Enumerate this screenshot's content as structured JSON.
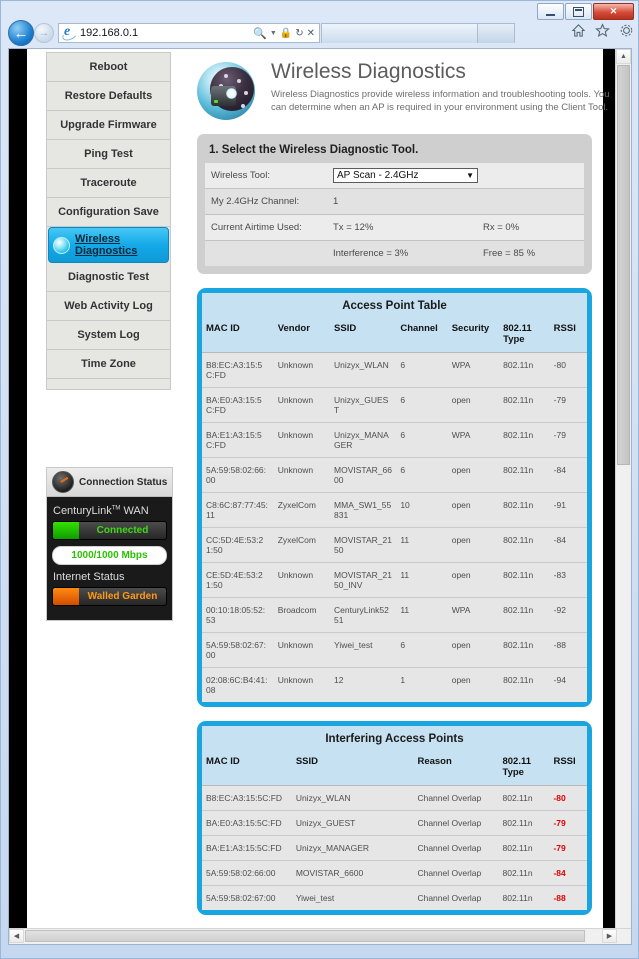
{
  "browser": {
    "url": "192.168.0.1",
    "back_icon": "back-arrow-icon",
    "forward_icon": "forward-arrow-icon",
    "search_icon": "magnifier-icon",
    "lock_icon": "lock-icon",
    "refresh_icon": "refresh-icon",
    "stop_icon": "close-icon",
    "home_icon": "home-icon",
    "favorites_icon": "star-icon",
    "tools_icon": "gear-icon",
    "minimize_label": "—",
    "maximize_label": "□",
    "close_label": "✕"
  },
  "sidebar": {
    "items": [
      {
        "label": "Reboot",
        "active": false
      },
      {
        "label": "Restore Defaults",
        "active": false
      },
      {
        "label": "Upgrade Firmware",
        "active": false
      },
      {
        "label": "Ping Test",
        "active": false
      },
      {
        "label": "Traceroute",
        "active": false
      },
      {
        "label": "Configuration Save",
        "active": false
      },
      {
        "label": "Wireless Diagnostics",
        "active": true
      },
      {
        "label": "Diagnostic Test",
        "active": false
      },
      {
        "label": "Web Activity Log",
        "active": false
      },
      {
        "label": "System Log",
        "active": false
      },
      {
        "label": "Time Zone",
        "active": false
      }
    ]
  },
  "connection_status": {
    "title": "Connection Status",
    "wan_label": "CenturyLink",
    "wan_trademark": "TM",
    "wan_suffix": "WAN",
    "wan_state": "Connected",
    "speed": "1000/1000 Mbps",
    "internet_label": "Internet Status",
    "internet_state": "Walled Garden",
    "colors": {
      "connected_green": "#3ddc14",
      "speed_green": "#2bbf00",
      "walled_orange": "#ff9a18"
    }
  },
  "header": {
    "title": "Wireless Diagnostics",
    "description": "Wireless Diagnostics provide wireless information and troubleshooting tools. You can determine when an AP is required in your environment using the Client Tool."
  },
  "tool_panel": {
    "heading": "1. Select the Wireless Diagnostic Tool.",
    "rows": [
      {
        "key": "Wireless Tool:",
        "value": "AP Scan - 2.4GHz",
        "type": "select"
      },
      {
        "key": "My 2.4GHz Channel:",
        "value": "1",
        "type": "text"
      },
      {
        "key": "Current Airtime Used:",
        "value": "Tx = 12%",
        "value2": "Rx = 0%",
        "type": "text"
      },
      {
        "key": "",
        "value": "Interference = 3%",
        "value2": "Free = 85 %",
        "type": "text"
      }
    ],
    "select_options": [
      "AP Scan - 2.4GHz"
    ]
  },
  "ap_table": {
    "caption": "Access Point Table",
    "columns": [
      "MAC ID",
      "Vendor",
      "SSID",
      "Channel",
      "Security",
      "802.11 Type",
      "RSSI"
    ],
    "rows": [
      [
        "B8:EC:A3:15:5C:FD",
        "Unknown",
        "Unizyx_WLAN",
        "6",
        "WPA",
        "802.11n",
        "-80"
      ],
      [
        "BA:E0:A3:15:5C:FD",
        "Unknown",
        "Unizyx_GUEST",
        "6",
        "open",
        "802.11n",
        "-79"
      ],
      [
        "BA:E1:A3:15:5C:FD",
        "Unknown",
        "Unizyx_MANAGER",
        "6",
        "WPA",
        "802.11n",
        "-79"
      ],
      [
        "5A:59:58:02:66:00",
        "Unknown",
        "MOVISTAR_6600",
        "6",
        "open",
        "802.11n",
        "-84"
      ],
      [
        "C8:6C:87:77:45:11",
        "ZyxelCom",
        "MMA_SW1_55831",
        "10",
        "open",
        "802.11n",
        "-91"
      ],
      [
        "CC:5D:4E:53:21:50",
        "ZyxelCom",
        "MOVISTAR_2150",
        "11",
        "open",
        "802.11n",
        "-84"
      ],
      [
        "CE:5D:4E:53:21:50",
        "Unknown",
        "MOVISTAR_2150_INV",
        "11",
        "open",
        "802.11n",
        "-83"
      ],
      [
        "00:10:18:05:52:53",
        "Broadcom",
        "CenturyLink5251",
        "11",
        "WPA",
        "802.11n",
        "-92"
      ],
      [
        "5A:59:58:02:67:00",
        "Unknown",
        "Yiwei_test",
        "6",
        "open",
        "802.11n",
        "-88"
      ],
      [
        "02:08:6C:B4:41:08",
        "Unknown",
        "12",
        "1",
        "open",
        "802.11n",
        "-94"
      ]
    ]
  },
  "interfering_table": {
    "caption": "Interfering Access Points",
    "columns": [
      "MAC ID",
      "SSID",
      "Reason",
      "802.11 Type",
      "RSSI"
    ],
    "rows": [
      [
        "B8:EC:A3:15:5C:FD",
        "Unizyx_WLAN",
        "Channel Overlap",
        "802.11n",
        "-80"
      ],
      [
        "BA:E0:A3:15:5C:FD",
        "Unizyx_GUEST",
        "Channel Overlap",
        "802.11n",
        "-79"
      ],
      [
        "BA:E1:A3:15:5C:FD",
        "Unizyx_MANAGER",
        "Channel Overlap",
        "802.11n",
        "-79"
      ],
      [
        "5A:59:58:02:66:00",
        "MOVISTAR_6600",
        "Channel Overlap",
        "802.11n",
        "-84"
      ],
      [
        "5A:59:58:02:67:00",
        "Yiwei_test",
        "Channel Overlap",
        "802.11n",
        "-88"
      ]
    ],
    "rssi_color": "#e00000"
  }
}
